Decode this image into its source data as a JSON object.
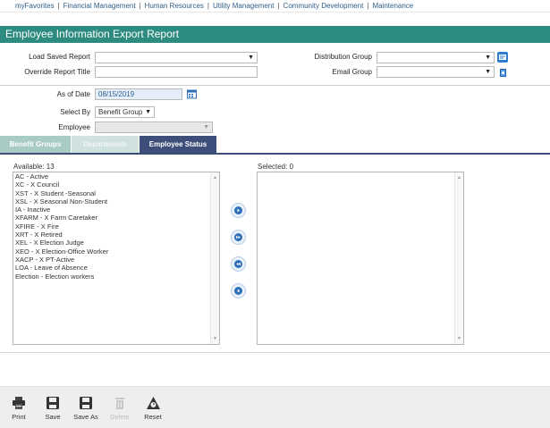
{
  "nav": {
    "items": [
      "myFavorites",
      "Financial Management",
      "Human Resources",
      "Utility Management",
      "Community Development",
      "Maintenance"
    ],
    "separator": "|"
  },
  "page": {
    "title": "Employee Information Export Report"
  },
  "form": {
    "load_saved_report_label": "Load Saved Report",
    "load_saved_report_value": "",
    "override_title_label": "Override Report Title",
    "override_title_value": "",
    "distribution_group_label": "Distribution Group",
    "distribution_group_value": "",
    "email_group_label": "Email Group",
    "email_group_value": "",
    "as_of_date_label": "As of Date",
    "as_of_date_value": "08/15/2019",
    "select_by_label": "Select By",
    "select_by_value": "Benefit Group",
    "employee_label": "Employee",
    "employee_value": ""
  },
  "tabs": [
    {
      "label": "Benefit Groups",
      "state": "inactive"
    },
    {
      "label": "Departments",
      "state": "disabled"
    },
    {
      "label": "Employee Status",
      "state": "active"
    }
  ],
  "available": {
    "caption": "Available: 13",
    "items": [
      "AC - Active",
      "XC - X Council",
      "XST - X Student -Seasonal",
      "XSL - X Seasonal Non-Student",
      "IA - Inactive",
      "XFARM - X Farm Caretaker",
      "XFIRE - X Fire",
      "XRT - X Retired",
      "XEL - X Election Judge",
      "XEO - X Election-Office Worker",
      "XACP - X PT-Active",
      "LOA - Leave of Absence",
      "Election - Election workers"
    ]
  },
  "selected": {
    "caption": "Selected: 0",
    "items": []
  },
  "toolbar": {
    "print": "Print",
    "save": "Save",
    "save_as": "Save As",
    "delete": "Delete",
    "reset": "Reset"
  },
  "colors": {
    "title_bar": "#2e8b80",
    "tab_active": "#3d4e7a",
    "tab_inactive": "#a9cbc6",
    "tab_disabled": "#cfe2df",
    "nav_link": "#2f5f8a",
    "date_field_bg": "#e4eef8"
  },
  "icons": {
    "distribution_group_button": "distribution-list-icon",
    "email_group_button": "email-book-icon",
    "calendar": "calendar-icon",
    "move_right": "move-right-icon",
    "move_all_right": "move-all-right-icon",
    "move_all_left": "move-all-left-icon",
    "move_left": "move-left-icon"
  }
}
